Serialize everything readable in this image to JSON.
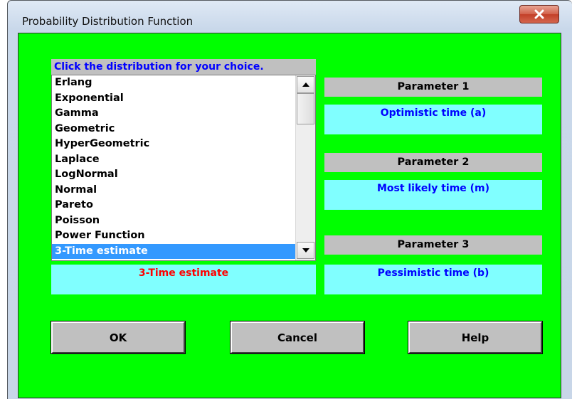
{
  "window": {
    "title": "Probability Distribution Function",
    "close_label": "X"
  },
  "prompt": "Click the distribution for your choice.",
  "distribution_list": {
    "items": [
      "Erlang",
      "Exponential",
      "Gamma",
      "Geometric",
      "HyperGeometric",
      "Laplace",
      "LogNormal",
      "Normal",
      "Pareto",
      "Poisson",
      "Power Function",
      "3-Time estimate"
    ],
    "selected": "3-Time estimate"
  },
  "chosen_distribution": "3-Time estimate",
  "parameters": [
    {
      "label": "Parameter 1",
      "value": "Optimistic time (a)"
    },
    {
      "label": "Parameter 2",
      "value": "Most likely time (m)"
    },
    {
      "label": "Parameter 3",
      "value": "Pessimistic time (b)"
    }
  ],
  "buttons": {
    "ok": "OK",
    "cancel": "Cancel",
    "help": "Help"
  },
  "colors": {
    "client_background": "#00ff00",
    "prompt_text": "#0000ff",
    "chosen_text": "#ff0000",
    "value_background": "#80ffff",
    "selection": "#3399ff"
  },
  "icons": [
    "close-icon",
    "scroll-up-arrow-icon",
    "scroll-down-arrow-icon"
  ]
}
